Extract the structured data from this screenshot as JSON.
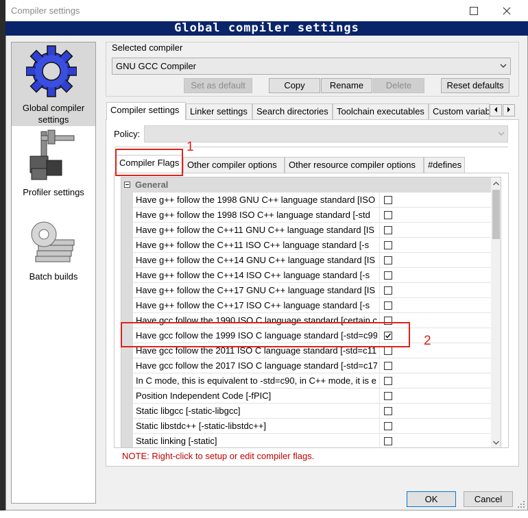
{
  "window": {
    "title": "Compiler settings",
    "banner": "Global compiler settings"
  },
  "sidebar": {
    "items": [
      {
        "label_line1": "Global compiler",
        "label_line2": "settings"
      },
      {
        "label_line1": "Profiler settings"
      },
      {
        "label_line1": "Batch builds"
      }
    ]
  },
  "selected_compiler": {
    "group_label": "Selected compiler",
    "value": "GNU GCC Compiler",
    "buttons": {
      "set_default": "Set as default",
      "copy": "Copy",
      "rename": "Rename",
      "delete": "Delete",
      "reset": "Reset defaults"
    }
  },
  "main_tabs": [
    "Compiler settings",
    "Linker settings",
    "Search directories",
    "Toolchain executables",
    "Custom variab"
  ],
  "policy_label": "Policy:",
  "sub_tabs": [
    "Compiler Flags",
    "Other compiler options",
    "Other resource compiler options",
    "#defines"
  ],
  "grid": {
    "category": "General",
    "rows": [
      {
        "label": "Have g++ follow the 1998 GNU C++ language standard  [ISO",
        "checked": false
      },
      {
        "label": "Have g++ follow the 1998 ISO C++ language standard  [-std",
        "checked": false
      },
      {
        "label": "Have g++ follow the C++11 GNU C++ language standard  [IS",
        "checked": false
      },
      {
        "label": "Have g++ follow the C++11 ISO C++ language standard  [-s",
        "checked": false
      },
      {
        "label": "Have g++ follow the C++14 GNU C++ language standard  [IS",
        "checked": false
      },
      {
        "label": "Have g++ follow the C++14 ISO C++ language standard  [-s",
        "checked": false
      },
      {
        "label": "Have g++ follow the C++17 GNU C++ language standard  [IS",
        "checked": false
      },
      {
        "label": "Have g++ follow the C++17 ISO C++ language standard  [-s",
        "checked": false
      },
      {
        "label": "Have gcc follow the 1990 ISO C language standard  [certain c",
        "checked": false
      },
      {
        "label": "Have gcc follow the 1999 ISO C language standard  [-std=c99",
        "checked": true
      },
      {
        "label": "Have gcc follow the 2011 ISO C language standard  [-std=c11",
        "checked": false
      },
      {
        "label": "Have gcc follow the 2017 ISO C language standard  [-std=c17",
        "checked": false
      },
      {
        "label": "In C mode, this is equivalent to -std=c90, in C++ mode, it is e",
        "checked": false
      },
      {
        "label": "Position Independent Code  [-fPIC]",
        "checked": false
      },
      {
        "label": "Static libgcc  [-static-libgcc]",
        "checked": false
      },
      {
        "label": "Static libstdc++  [-static-libstdc++]",
        "checked": false
      },
      {
        "label": "Static linking  [-static]",
        "checked": false
      }
    ]
  },
  "note": "NOTE: Right-click to setup or edit compiler flags.",
  "footer": {
    "ok": "OK",
    "cancel": "Cancel"
  },
  "annotations": {
    "one": "1",
    "two": "2"
  },
  "colors": {
    "banner": "#0a246a",
    "annotation": "#e0201a"
  }
}
